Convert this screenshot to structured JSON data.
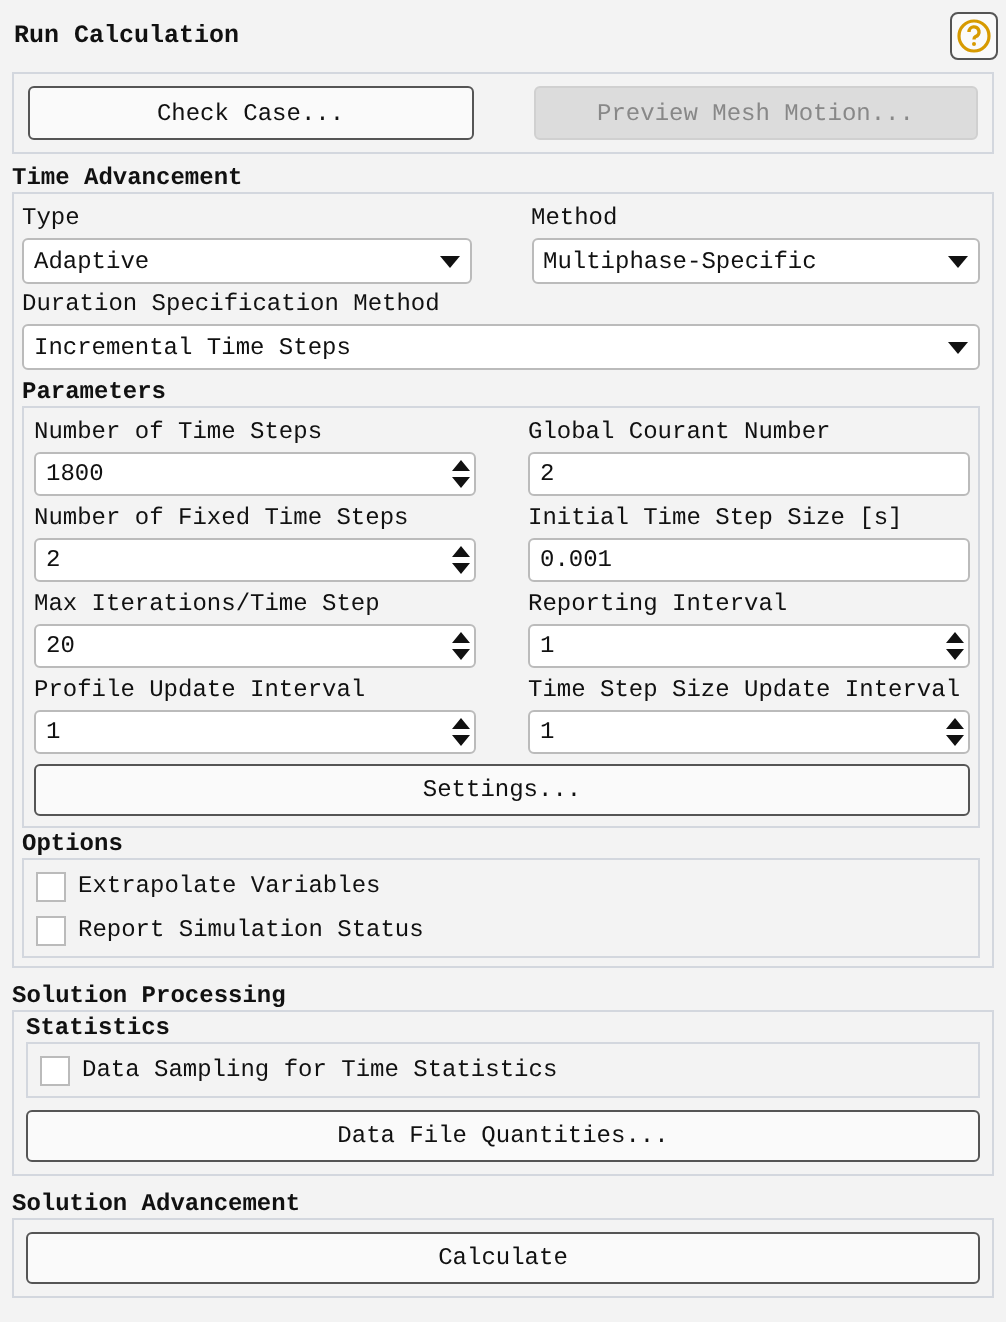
{
  "title": "Run Calculation",
  "top_buttons": [
    {
      "label": "Check Case...",
      "disabled": false
    },
    {
      "label": "Preview Mesh Motion...",
      "disabled": true
    }
  ],
  "time_advancement": {
    "title": "Time Advancement",
    "dropdowns": [
      {
        "label": "Type",
        "value": "Adaptive",
        "wide": false
      },
      {
        "label": "Method",
        "value": "Multiphase-Specific",
        "wide": false
      },
      {
        "label": "Duration Specification Method",
        "value": "Incremental Time Steps",
        "wide": true
      }
    ],
    "parameters": {
      "title": "Parameters",
      "fields": [
        {
          "label": "Number of Time Steps",
          "value": "1800",
          "kind": "spin"
        },
        {
          "label": "Global Courant Number",
          "value": "2",
          "kind": "text"
        },
        {
          "label": "Number of Fixed Time Steps",
          "value": "2",
          "kind": "spin"
        },
        {
          "label": "Initial Time Step Size [s]",
          "value": "0.001",
          "kind": "text"
        },
        {
          "label": "Max Iterations/Time Step",
          "value": "20",
          "kind": "spin"
        },
        {
          "label": "Reporting Interval",
          "value": "1",
          "kind": "spin"
        },
        {
          "label": "Profile Update Interval",
          "value": "1",
          "kind": "spin"
        },
        {
          "label": "Time Step Size Update Interval",
          "value": "1",
          "kind": "spin"
        }
      ],
      "button": "Settings..."
    },
    "options": {
      "title": "Options",
      "items": [
        {
          "label": "Extrapolate Variables",
          "checked": false
        },
        {
          "label": "Report Simulation Status",
          "checked": false
        }
      ]
    }
  },
  "solution_processing": {
    "title": "Solution Processing",
    "statistics": {
      "title": "Statistics",
      "items": [
        {
          "label": "Data Sampling for Time Statistics",
          "checked": false
        }
      ]
    },
    "button": "Data File Quantities..."
  },
  "solution_advancement": {
    "title": "Solution Advancement",
    "button": "Calculate"
  }
}
